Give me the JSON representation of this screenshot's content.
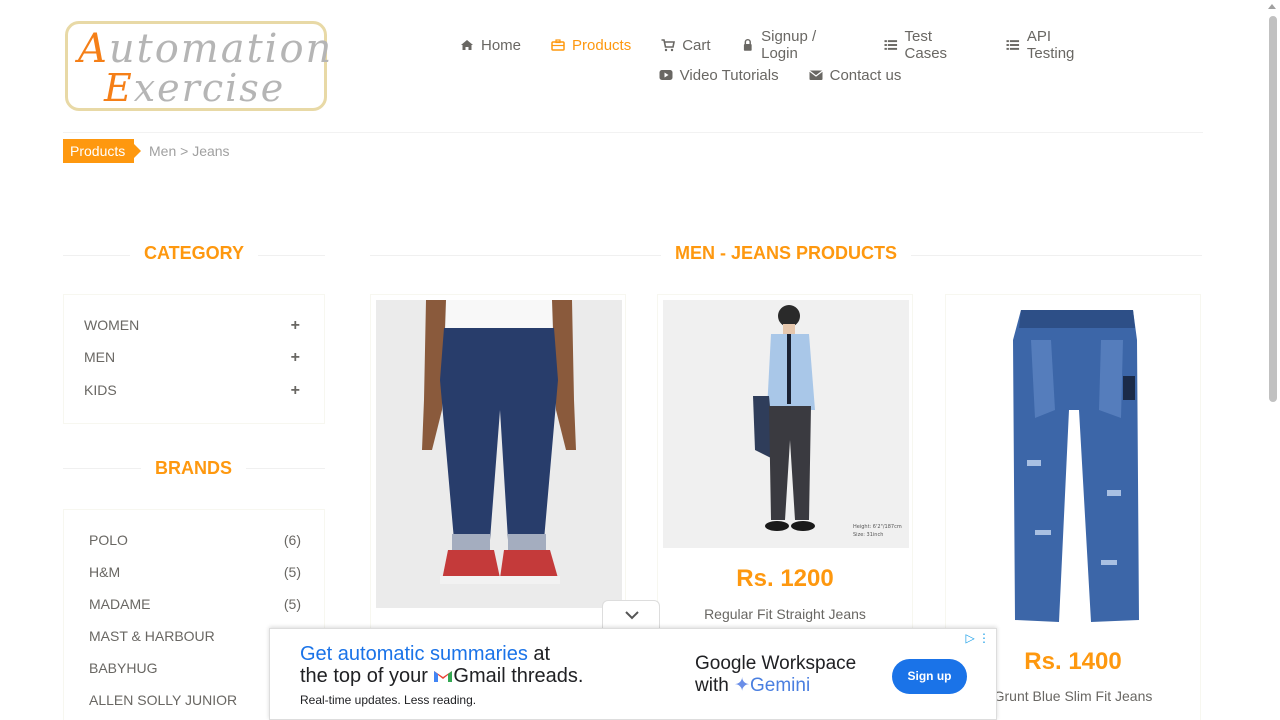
{
  "logo": {
    "line1_cap": "A",
    "line1_rest": "utomation",
    "line2_cap": "E",
    "line2_rest": "xercise"
  },
  "nav": {
    "items": [
      {
        "label": "Home",
        "icon": "home-icon",
        "active": false
      },
      {
        "label": "Products",
        "icon": "briefcase-icon",
        "active": true
      },
      {
        "label": "Cart",
        "icon": "cart-icon",
        "active": false
      },
      {
        "label": "Signup / Login",
        "icon": "lock-icon",
        "active": false
      },
      {
        "label": "Test Cases",
        "icon": "list-icon",
        "active": false
      },
      {
        "label": "API Testing",
        "icon": "list-icon",
        "active": false
      },
      {
        "label": "Video Tutorials",
        "icon": "youtube-icon",
        "active": false
      },
      {
        "label": "Contact us",
        "icon": "envelope-icon",
        "active": false
      }
    ]
  },
  "breadcrumb": {
    "tag": "Products",
    "path": "Men > Jeans"
  },
  "sidebar": {
    "category_title": "Category",
    "categories": [
      {
        "label": "WOMEN"
      },
      {
        "label": "MEN"
      },
      {
        "label": "KIDS"
      }
    ],
    "brands_title": "Brands",
    "brands": [
      {
        "name": "POLO",
        "count": "(6)"
      },
      {
        "name": "H&M",
        "count": "(5)"
      },
      {
        "name": "MADAME",
        "count": "(5)"
      },
      {
        "name": "MAST & HARBOUR",
        "count": ""
      },
      {
        "name": "BABYHUG",
        "count": ""
      },
      {
        "name": "ALLEN SOLLY JUNIOR",
        "count": ""
      }
    ]
  },
  "main": {
    "title": "Men - Jeans Products",
    "products": [
      {
        "price": "",
        "name": ""
      },
      {
        "price": "Rs. 1200",
        "name": "Regular Fit Straight Jeans",
        "photo_note": "Height: 6'2\"/187cm\nSize: 31inch"
      },
      {
        "price": "Rs. 1400",
        "name": "Grunt Blue Slim Fit Jeans"
      }
    ]
  },
  "ad": {
    "headline_blue": "Get automatic summaries",
    "headline_rest1": " at",
    "headline_line2a": "the top of your ",
    "headline_line2b": "Gmail threads.",
    "subtext": "Real-time updates. Less reading.",
    "brand_line1": "Google Workspace",
    "brand_line2a": "with ",
    "brand_line2b": "Gemini",
    "button": "Sign up",
    "choice": "▷ ⋮",
    "colors": {
      "accent": "#1a73e8"
    }
  },
  "theme": {
    "accent": "#fe980f",
    "text": "#696763"
  }
}
